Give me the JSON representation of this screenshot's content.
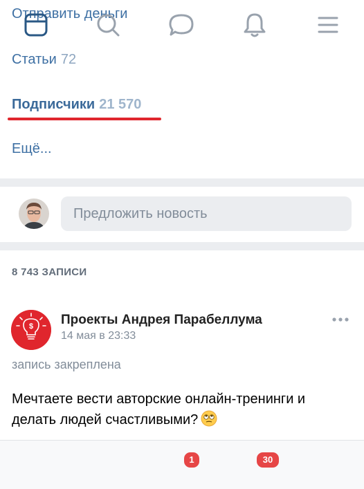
{
  "links": {
    "send_money": "Отправить деньги",
    "articles_label": "Статьи",
    "articles_count": "72",
    "subscribers_label": "Подписчики",
    "subscribers_count": "21 570",
    "more": "Ещё..."
  },
  "suggest": {
    "placeholder": "Предложить новость"
  },
  "wall": {
    "posts_count": "8 743 ЗАПИСИ"
  },
  "post": {
    "author": "Проекты Андрея Парабеллума",
    "date": "14 мая в 23:33",
    "pinned_label": "запись закреплена",
    "text": "Мечтаете вести авторские онлайн-тренинги и делать людей счастливыми?",
    "emoji": "rolling-eyes-emoji"
  },
  "tabbar": {
    "items": [
      "feed-icon",
      "search-icon",
      "messages-icon",
      "notifications-icon",
      "menu-icon"
    ],
    "messages_badge": "1",
    "notifications_badge": "30"
  },
  "colors": {
    "link": "#3d6fa3",
    "accent_red": "#e0262d",
    "badge": "#e64646",
    "separator": "#ebedf0",
    "tab_icon": "#99a2ad",
    "tab_active": "#2a5885"
  }
}
